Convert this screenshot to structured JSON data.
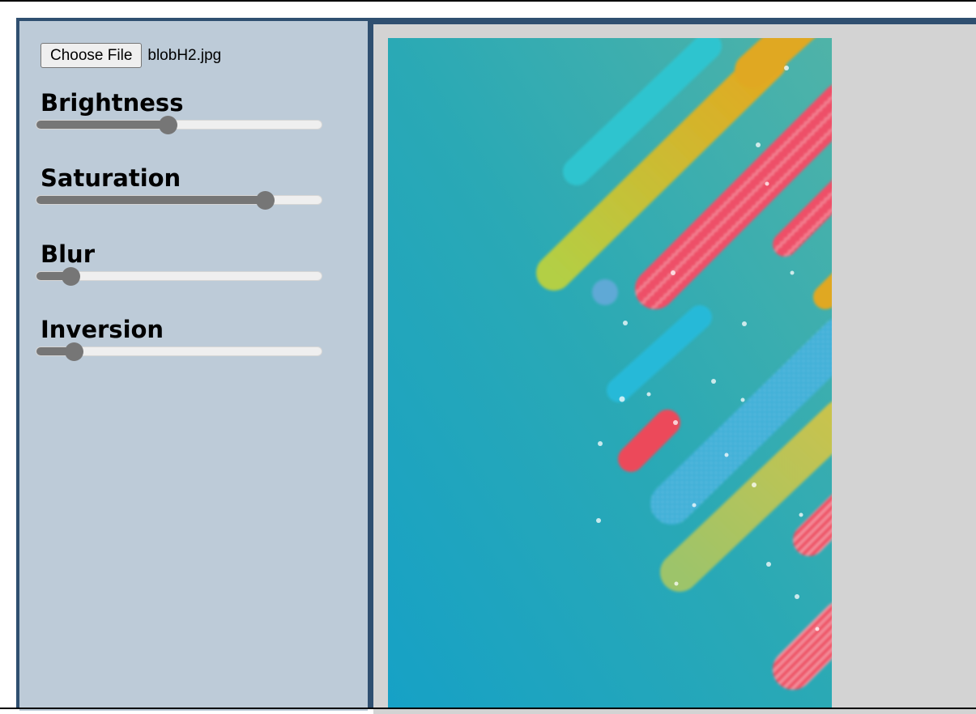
{
  "file": {
    "button_label": "Choose File",
    "selected_name": "blobH2.jpg"
  },
  "controls": [
    {
      "label": "Brightness",
      "value_percent": 46
    },
    {
      "label": "Saturation",
      "value_percent": 80
    },
    {
      "label": "Blur",
      "value_percent": 12
    },
    {
      "label": "Inversion",
      "value_percent": 13
    }
  ],
  "colors": {
    "frame": "#2f4f70",
    "panel": "#bdcbd8",
    "viewer": "#d3d3d3",
    "slider_fill": "#767676",
    "slider_track": "#efefef"
  },
  "preview": {
    "icon": "abstract-diagonal-stripes-image"
  }
}
